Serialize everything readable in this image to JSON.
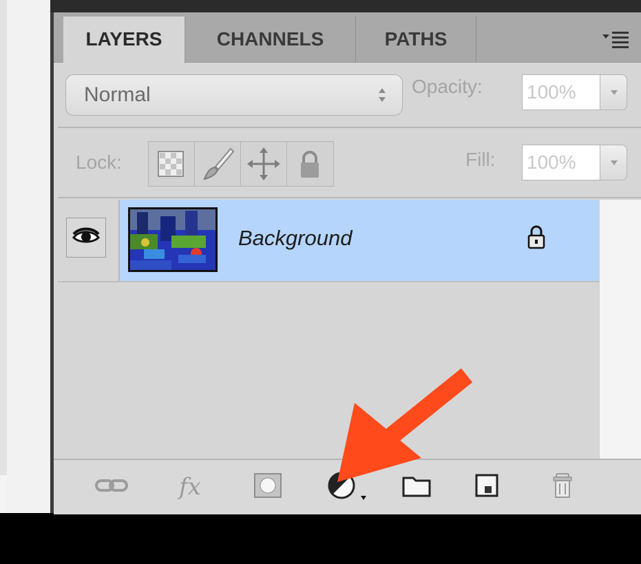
{
  "tabs": [
    {
      "label": "LAYERS",
      "active": true
    },
    {
      "label": "CHANNELS",
      "active": false
    },
    {
      "label": "PATHS",
      "active": false
    }
  ],
  "blend_mode": {
    "value": "Normal"
  },
  "opacity": {
    "label": "Opacity:",
    "value": "100%"
  },
  "lock": {
    "label": "Lock:"
  },
  "fill": {
    "label": "Fill:",
    "value": "100%"
  },
  "layers": [
    {
      "name": "Background",
      "visible": true,
      "locked": true,
      "selected": true
    }
  ],
  "bottom_toolbar": [
    "link-layers-icon",
    "add-layer-style-icon",
    "add-mask-icon",
    "new-fill-adjustment-layer-icon",
    "new-group-icon",
    "new-layer-icon",
    "delete-layer-icon"
  ],
  "colors": {
    "selection": "#b5d5fc",
    "annotation_arrow": "#ff4a1c",
    "panel_bg": "#d6d6d6"
  }
}
